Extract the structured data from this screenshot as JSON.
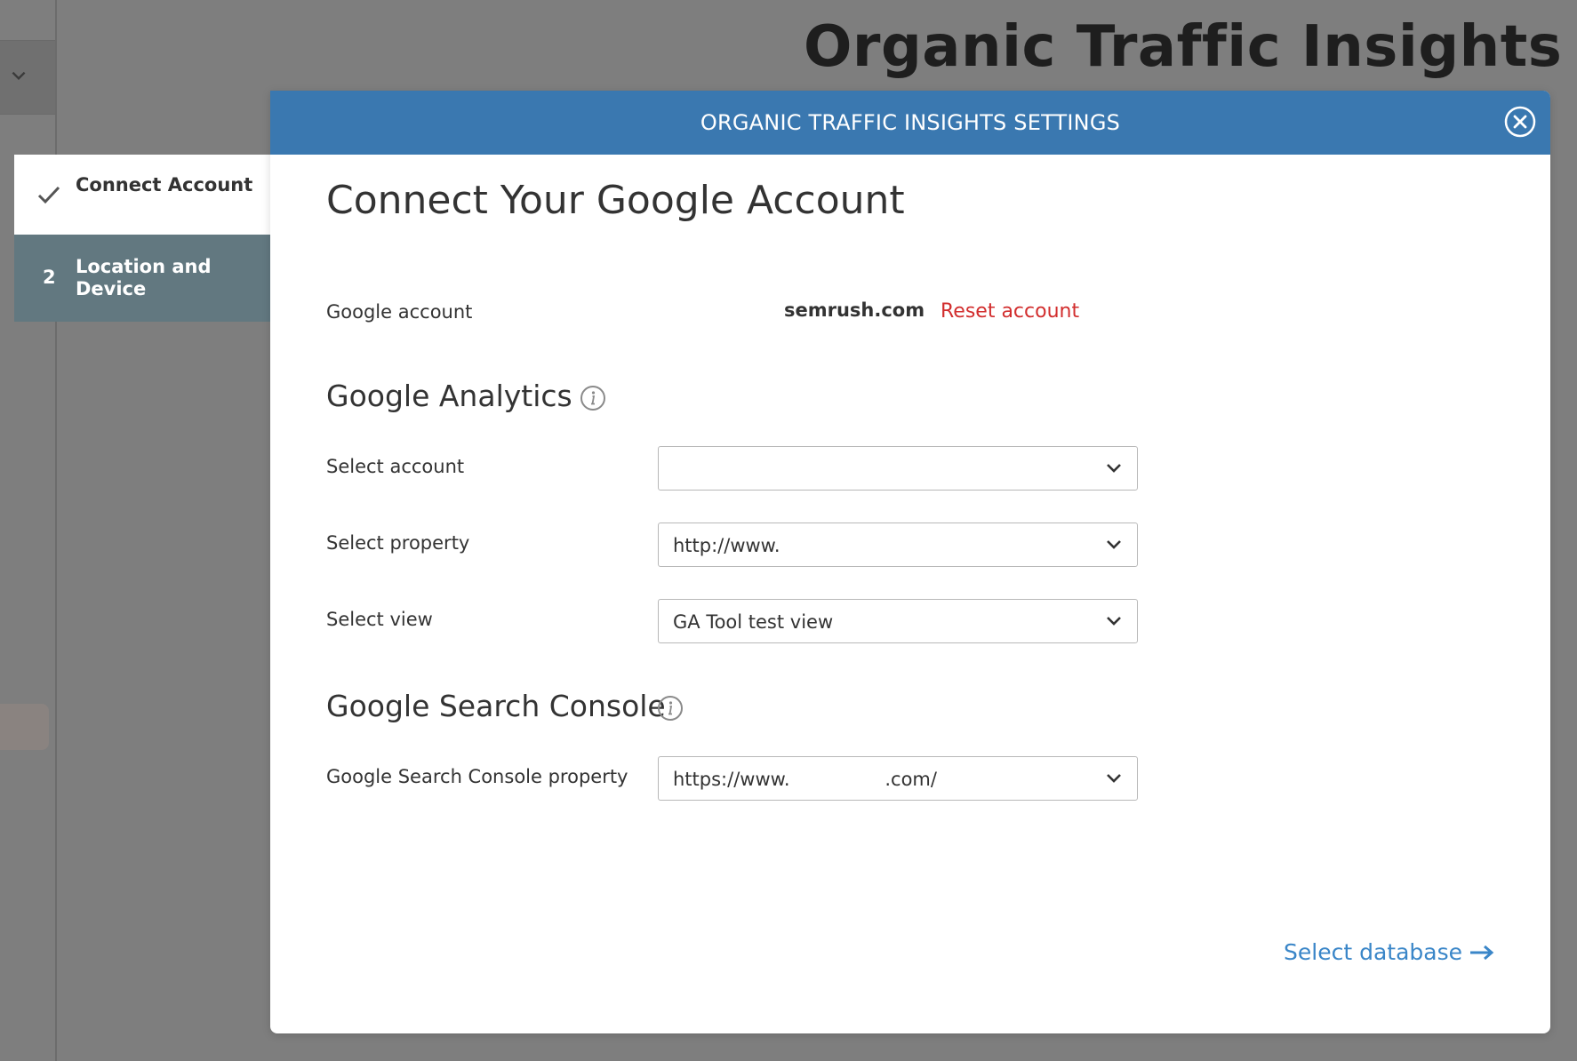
{
  "background": {
    "page_title": "Organic Traffic Insights"
  },
  "steps": [
    {
      "label": "Connect Account",
      "status": "completed"
    },
    {
      "number": "2",
      "label": "Location and Device",
      "status": "current"
    }
  ],
  "modal": {
    "title": "ORGANIC TRAFFIC INSIGHTS SETTINGS",
    "close_icon": "close-circle-icon",
    "heading": "Connect Your Google Account",
    "google_account": {
      "label": "Google account",
      "value": "semrush.com",
      "reset_label": "Reset account"
    },
    "analytics": {
      "title": "Google Analytics",
      "info_icon": "info-icon",
      "fields": [
        {
          "label": "Select account",
          "value": ""
        },
        {
          "label": "Select property",
          "value": "http://www."
        },
        {
          "label": "Select view",
          "value": "GA Tool test view"
        }
      ]
    },
    "search_console": {
      "title": "Google Search Console",
      "info_icon": "info-icon",
      "property_label": "Google Search Console property",
      "property_value": "https://www.                .com/"
    },
    "next_label": "Select database",
    "next_icon": "arrow-right-icon"
  },
  "colors": {
    "header_blue": "#3a78b0",
    "link_blue": "#3a86c8",
    "reset_red": "#d22e2e",
    "step_active_bg": "#627880"
  }
}
